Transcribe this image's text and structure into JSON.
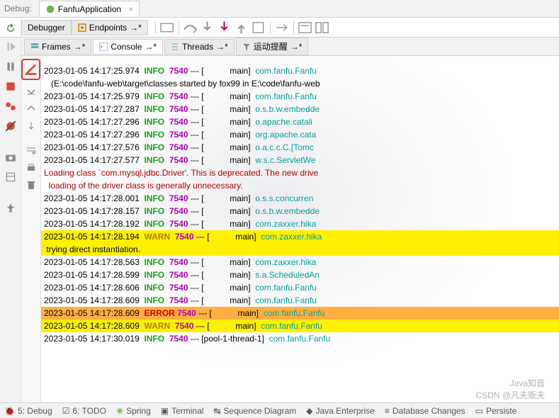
{
  "header": {
    "debug_label": "Debug:",
    "app_tab": "FanfuApplication"
  },
  "second_row": {
    "debugger_tab": "Debugger",
    "endpoints_tab": "Endpoints"
  },
  "inner_tabs": {
    "frames": "Frames",
    "console": "Console",
    "threads": "Threads",
    "motion": "运动提醒"
  },
  "console_lines": [
    {
      "ts": "2023-01-05 14:17:25.974",
      "level": "INFO",
      "pid": "7540",
      "thread": "main",
      "logger": "com.fanfu.Fanfu",
      "bg": ""
    },
    {
      "raw": "   (E:\\code\\fanfu-web\\target\\classes started by fox99 in E:\\code\\fanfu-web",
      "bg": ""
    },
    {
      "ts": "2023-01-05 14:17:25.979",
      "level": "INFO",
      "pid": "7540",
      "thread": "main",
      "logger": "com.fanfu.Fanfu",
      "bg": ""
    },
    {
      "ts": "2023-01-05 14:17:27.287",
      "level": "INFO",
      "pid": "7540",
      "thread": "main",
      "logger": "o.s.b.w.embedde",
      "bg": ""
    },
    {
      "ts": "2023-01-05 14:17:27.296",
      "level": "INFO",
      "pid": "7540",
      "thread": "main",
      "logger": "o.apache.catali",
      "bg": ""
    },
    {
      "ts": "2023-01-05 14:17:27.296",
      "level": "INFO",
      "pid": "7540",
      "thread": "main",
      "logger": "org.apache.cata",
      "bg": ""
    },
    {
      "ts": "2023-01-05 14:17:27.576",
      "level": "INFO",
      "pid": "7540",
      "thread": "main",
      "logger": "o.a.c.c.C.[Tomc",
      "bg": ""
    },
    {
      "ts": "2023-01-05 14:17:27.577",
      "level": "INFO",
      "pid": "7540",
      "thread": "main",
      "logger": "w.s.c.ServletWe",
      "bg": ""
    },
    {
      "redraw": "Loading class `com.mysql.jdbc.Driver'. This is deprecated. The new drive",
      "bg": ""
    },
    {
      "redraw": "  loading of the driver class is generally unnecessary.",
      "bg": ""
    },
    {
      "ts": "2023-01-05 14:17:28.001",
      "level": "INFO",
      "pid": "7540",
      "thread": "main",
      "logger": "o.s.s.concurren",
      "bg": ""
    },
    {
      "ts": "2023-01-05 14:17:28.157",
      "level": "INFO",
      "pid": "7540",
      "thread": "main",
      "logger": "o.s.b.w.embedde",
      "bg": ""
    },
    {
      "ts": "2023-01-05 14:17:28.192",
      "level": "INFO",
      "pid": "7540",
      "thread": "main",
      "logger": "com.zaxxer.hika",
      "bg": ""
    },
    {
      "ts": "2023-01-05 14:17:28.194",
      "level": "WARN",
      "pid": "7540",
      "thread": "main",
      "logger": "com.zaxxer.hika",
      "bg": "yellow"
    },
    {
      "raw": " trying direct instantiation.",
      "bg": "yellow"
    },
    {
      "ts": "2023-01-05 14:17:28.563",
      "level": "INFO",
      "pid": "7540",
      "thread": "main",
      "logger": "com.zaxxer.hika",
      "bg": ""
    },
    {
      "ts": "2023-01-05 14:17:28.599",
      "level": "INFO",
      "pid": "7540",
      "thread": "main",
      "logger": "s.a.ScheduledAn",
      "bg": ""
    },
    {
      "ts": "2023-01-05 14:17:28.606",
      "level": "INFO",
      "pid": "7540",
      "thread": "main",
      "logger": "com.fanfu.Fanfu",
      "bg": ""
    },
    {
      "ts": "2023-01-05 14:17:28.609",
      "level": "INFO",
      "pid": "7540",
      "thread": "main",
      "logger": "com.fanfu.Fanfu",
      "bg": ""
    },
    {
      "ts": "2023-01-05 14:17:28.609",
      "level": "ERROR",
      "pid": "7540",
      "thread": "main",
      "logger": "com.fanfu.Fanfu",
      "bg": "orange"
    },
    {
      "ts": "2023-01-05 14:17:28.609",
      "level": "WARN",
      "pid": "7540",
      "thread": "main",
      "logger": "com.fanfu.Fanfu",
      "bg": "yellow"
    },
    {
      "ts": "2023-01-05 14:17:30.019",
      "level": "INFO",
      "pid": "7540",
      "thread": "pool-1-thread-1",
      "logger": "com.fanfu.Fanfu",
      "bg": ""
    }
  ],
  "bottom": {
    "debug": "5: Debug",
    "todo": "6: TODO",
    "spring": "Spring",
    "terminal": "Terminal",
    "seq": "Sequence Diagram",
    "java": "Java Enterprise",
    "db": "Database Changes",
    "persist": "Persiste"
  },
  "watermark": {
    "line1": "Java知音",
    "line2": "CSDN @凡夫贩夫"
  }
}
